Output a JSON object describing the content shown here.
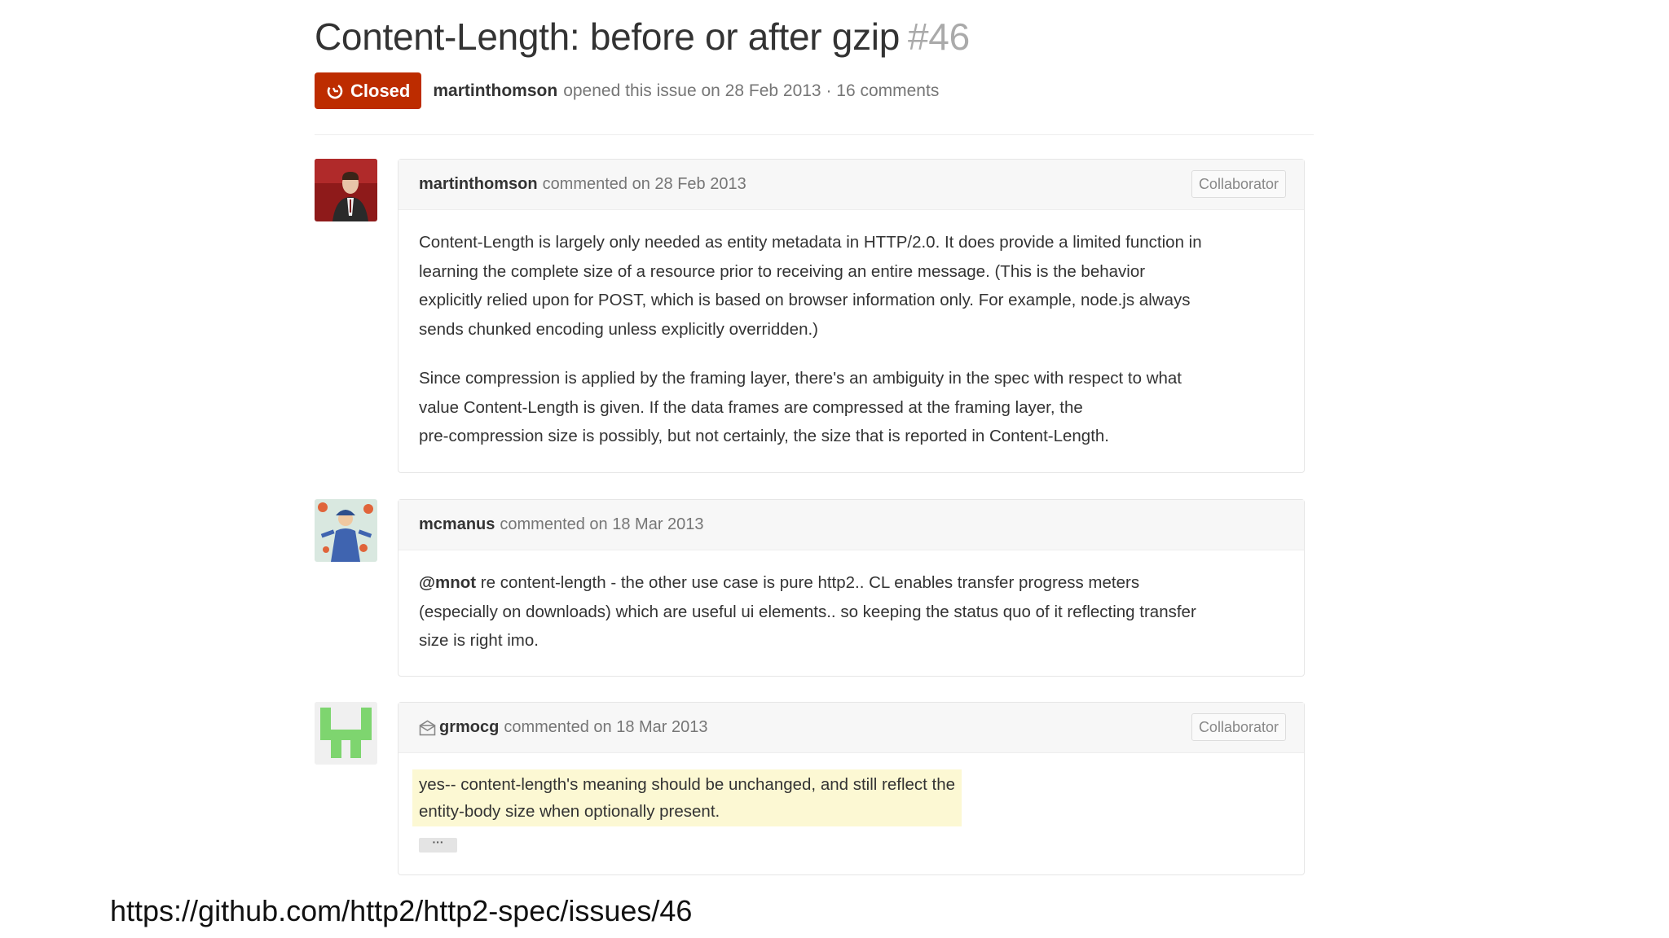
{
  "issue": {
    "title": "Content-Length: before or after gzip",
    "number": "#46",
    "state_label": "Closed",
    "author": "martinthomson",
    "meta_text": "opened this issue on 28 Feb 2013 · 16 comments"
  },
  "comments": [
    {
      "author": "martinthomson",
      "meta": "commented on 28 Feb 2013",
      "role": "Collaborator",
      "avatar": "avatar-photo",
      "paragraph1": [
        "Content-Length is largely only needed as entity metadata in HTTP/2.0. It does provide a limited function in",
        "learning the complete size of a resource prior to receiving an entire message. (This is the behavior",
        "explicitly relied upon for POST, which is based on browser information only. For example, node.js always",
        "sends chunked encoding unless explicitly overridden.)"
      ],
      "paragraph2": [
        "Since compression is applied by the framing layer, there's an ambiguity in the spec with respect to what",
        "value Content-Length is given. If the data frames are compressed at the framing layer, the",
        "pre-compression size is possibly, but not certainly, the size that is reported in Content-Length."
      ]
    },
    {
      "author": "mcmanus",
      "meta": "commented on 18 Mar 2013",
      "avatar": "avatar-illustration",
      "mention": "@mnot",
      "lines": [
        " re content-length - the other use case is pure http2.. CL enables transfer progress meters",
        "(especially on downloads) which are useful ui elements.. so keeping the status quo of it reflecting transfer",
        "size is right imo."
      ]
    },
    {
      "author": "grmocg",
      "meta": "commented on 18 Mar 2013",
      "role": "Collaborator",
      "avatar": "avatar-identicon",
      "icon": "mail-icon",
      "lines": [
        "yes-- content-length's meaning should be unchanged, and still reflect the",
        "entity-body size when optionally present."
      ],
      "ellipsis": "···"
    }
  ],
  "source_url": "https://github.com/http2/http2-spec/issues/46",
  "colors": {
    "closed_badge": "#bd2c00",
    "header_bg": "#f7f7f7",
    "highlight": "#fcf8d3",
    "identicon": "#7ed56f"
  }
}
